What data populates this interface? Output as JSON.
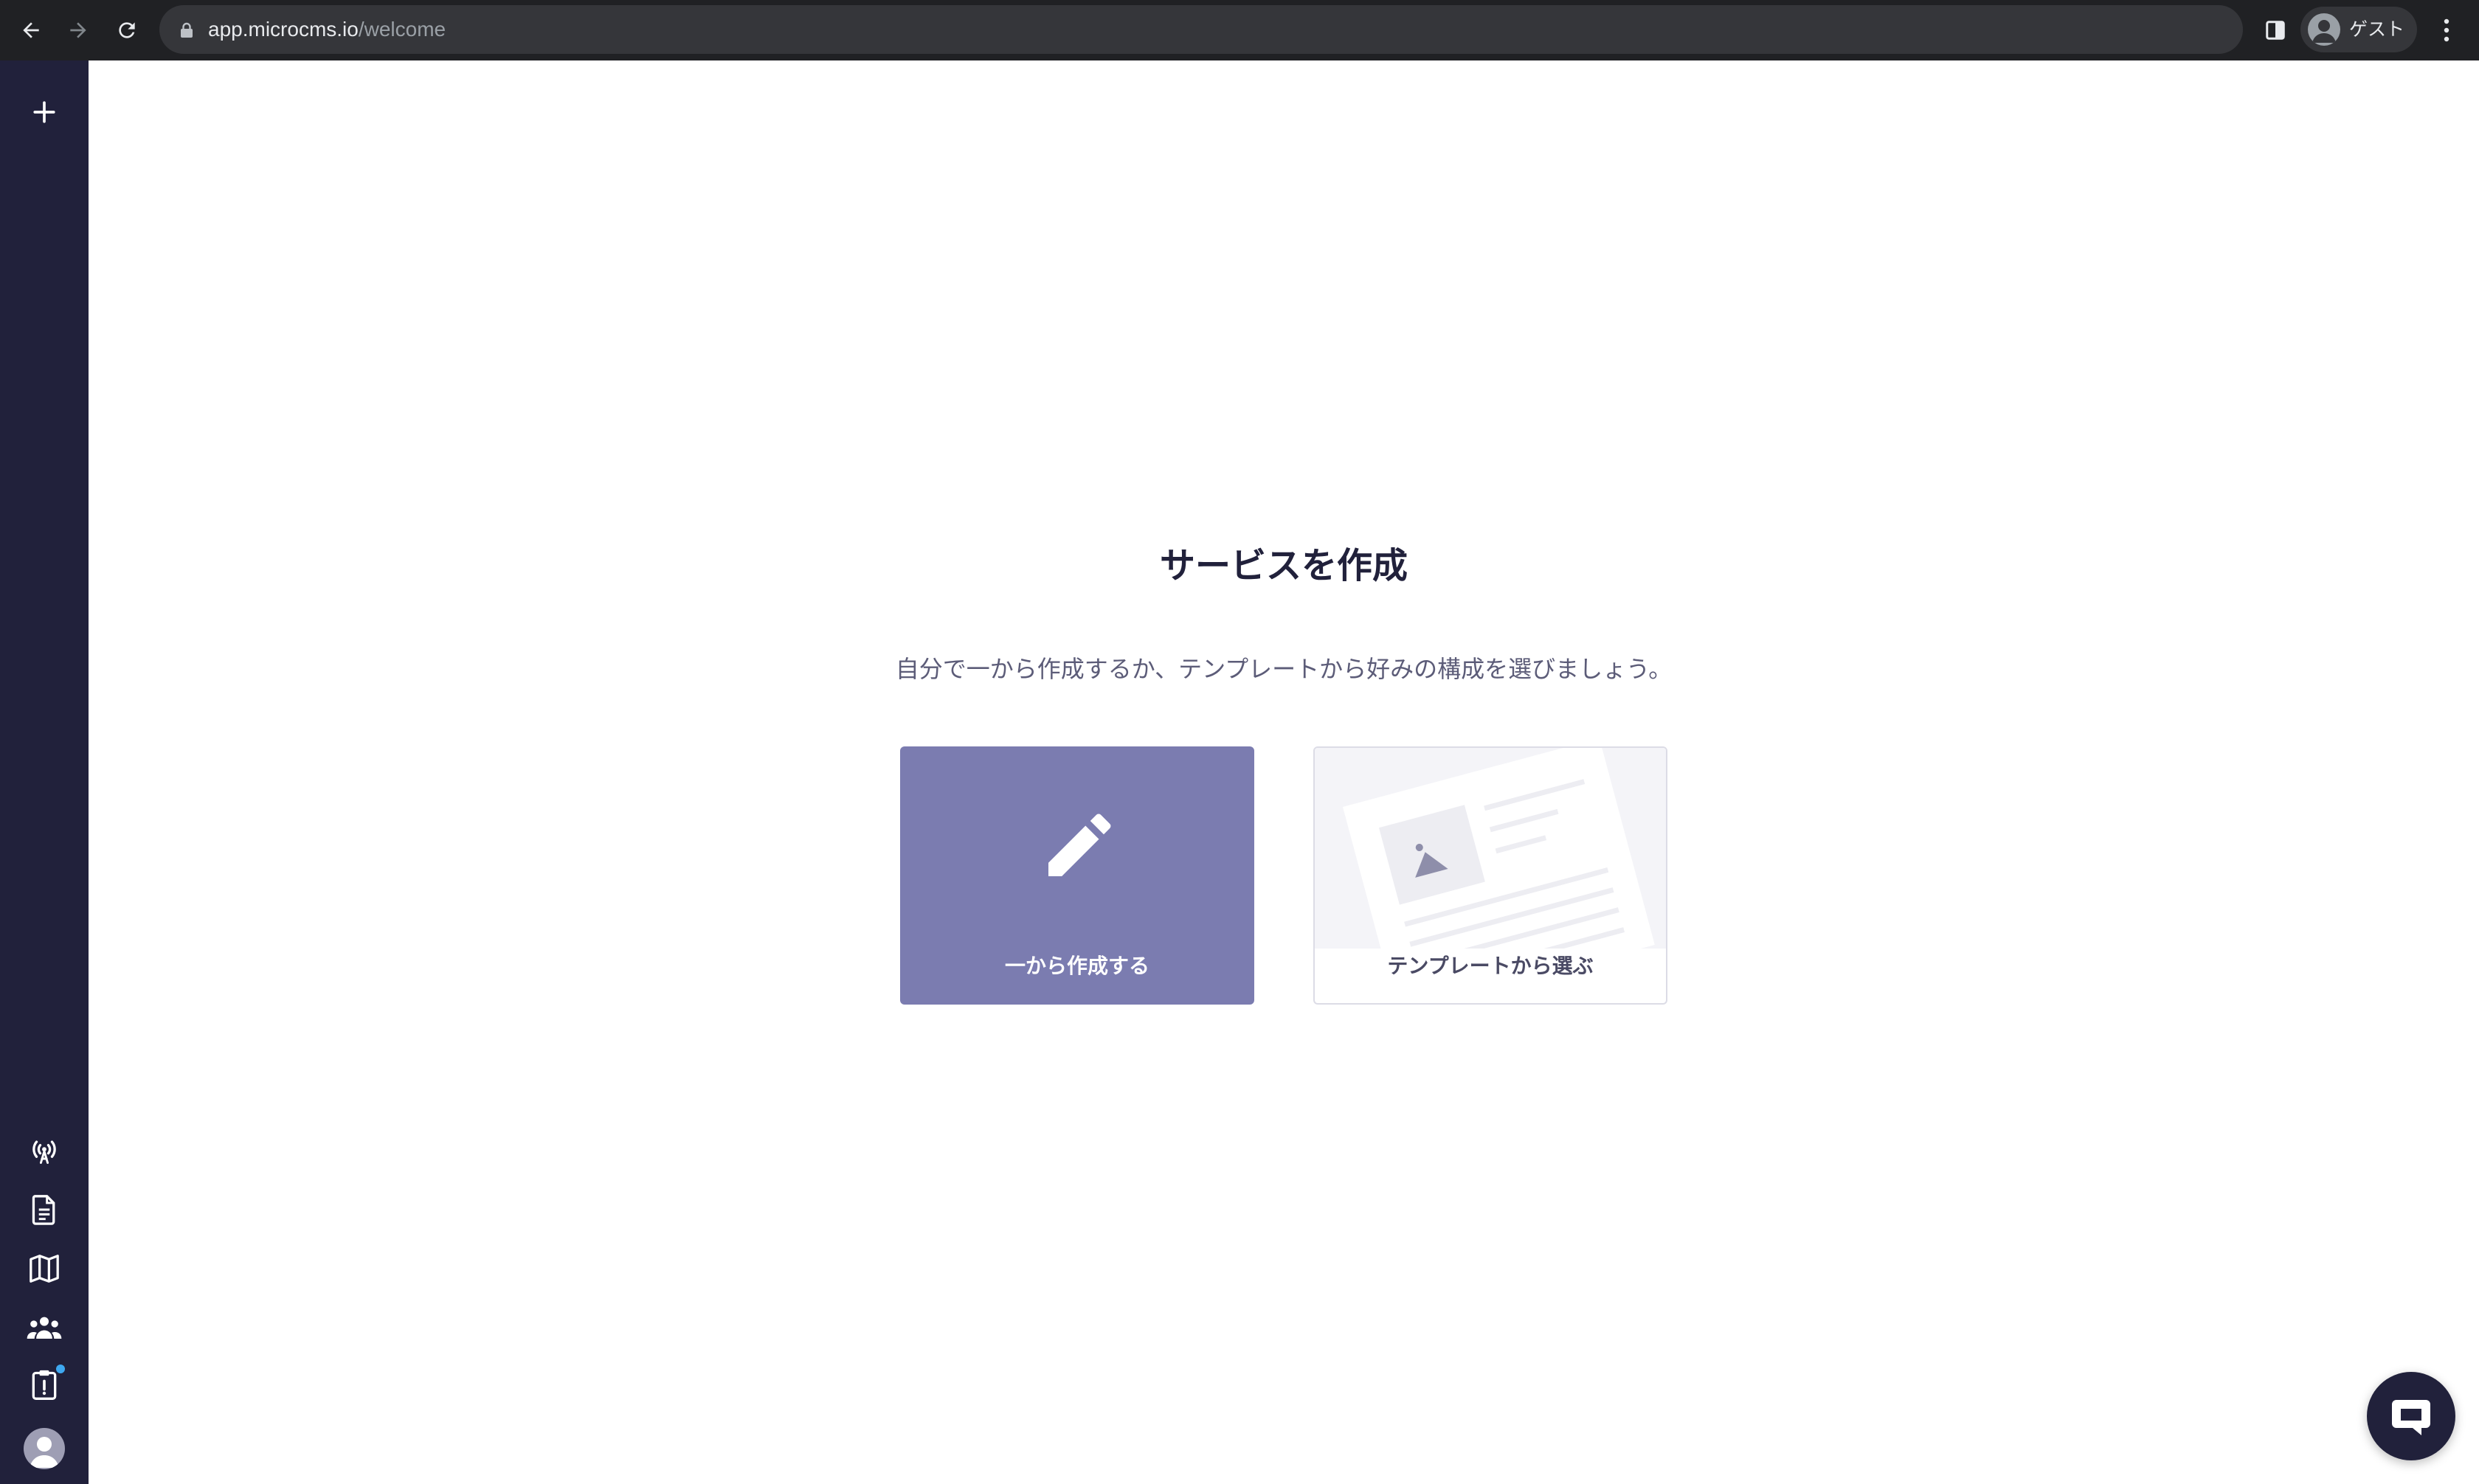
{
  "browser": {
    "url_host": "app.microcms.io",
    "url_path": "/welcome",
    "profile_label": "ゲスト",
    "icons": [
      "back-arrow-icon",
      "forward-arrow-icon",
      "reload-icon",
      "lock-icon",
      "sidepanel-icon",
      "profile-icon",
      "kebab-menu-icon"
    ]
  },
  "sidebar": {
    "icons": [
      "plus-icon",
      "broadcast-icon",
      "document-icon",
      "map-icon",
      "team-icon",
      "alert-clipboard-icon",
      "user-avatar-icon"
    ],
    "colors": {
      "background": "#21213b",
      "notification_dot": "#3ea8f0"
    }
  },
  "main": {
    "title": "サービスを作成",
    "subtitle": "自分で一から作成するか、テンプレートから好みの構成を選びましょう。",
    "cards": [
      {
        "label": "一から作成する",
        "icon": "pencil-icon",
        "color": "#7b7cb0"
      },
      {
        "label": "テンプレートから選ぶ",
        "icon": "template-illustration-icon",
        "color": "#ffffff"
      }
    ]
  },
  "chat": {
    "icon": "chat-bubble-icon",
    "color": "#21213b"
  }
}
